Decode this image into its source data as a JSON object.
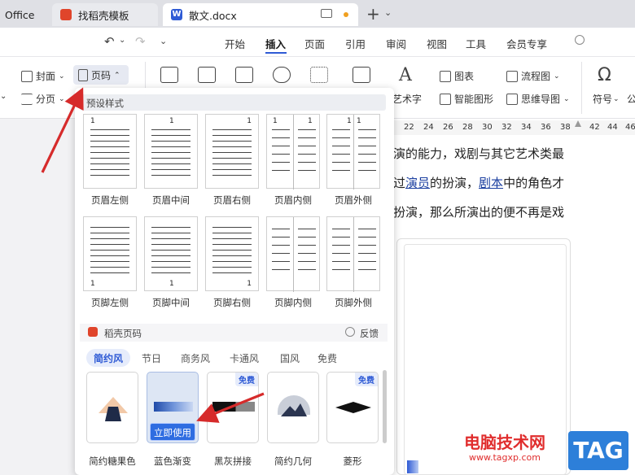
{
  "titlebar": {
    "tabs": [
      {
        "label": "Office"
      },
      {
        "label": "找稻壳模板"
      },
      {
        "label": "散文.docx"
      }
    ],
    "doc_badge": "W"
  },
  "menubar": {
    "items": [
      "开始",
      "插入",
      "页面",
      "引用",
      "审阅",
      "视图",
      "工具",
      "会员专享"
    ],
    "active": "插入"
  },
  "ribbon": {
    "cover_label": "封面",
    "section_label": "分页",
    "page_number_label": "页码",
    "chart_label": "图表",
    "flowchart_label": "流程图",
    "art_text_label": "艺术字",
    "smart_shape_label": "智能图形",
    "mindmap_label": "思维导图",
    "symbol_label": "符号",
    "formula_label": "公"
  },
  "ruler": {
    "ticks": [
      "22",
      "24",
      "26",
      "28",
      "30",
      "32",
      "34",
      "36",
      "38",
      "42",
      "44",
      "46"
    ]
  },
  "document": {
    "line1": "演的能力，戏剧与其它艺术类最",
    "line2_a": "过",
    "line2_link1": "演员",
    "line2_b": "的扮演，",
    "line2_link2": "剧本",
    "line2_c": "中的角色才",
    "line3": "扮演，那么所演出的便不再是戏"
  },
  "panel": {
    "preset_title": "预设样式",
    "header_presets": [
      "页眉左侧",
      "页眉中间",
      "页眉右侧",
      "页眉内侧",
      "页眉外侧"
    ],
    "footer_presets": [
      "页脚左侧",
      "页脚中间",
      "页脚右侧",
      "页脚内侧",
      "页脚外侧"
    ],
    "page_num": "1",
    "docer_title": "稻壳页码",
    "feedback_label": "反馈",
    "category_tabs": [
      "简约风",
      "节日",
      "商务风",
      "卡通风",
      "国风",
      "免费"
    ],
    "active_category": "简约风",
    "templates": [
      {
        "name": "简约糖果色",
        "free": ""
      },
      {
        "name": "蓝色渐变",
        "free": ""
      },
      {
        "name": "黑灰拼接",
        "free": "免费"
      },
      {
        "name": "简约几何",
        "free": ""
      },
      {
        "name": "菱形",
        "free": "免费"
      }
    ],
    "use_button": "立即使用"
  },
  "watermark": {
    "cn": "电脑技术网",
    "url": "www.tagxp.com",
    "tag": "TAG"
  },
  "colors": {
    "accent": "#2f5bd5",
    "arrow": "#d62b2b",
    "watermark_red": "#e02d2d",
    "tag_blue": "#2d7fd9"
  }
}
